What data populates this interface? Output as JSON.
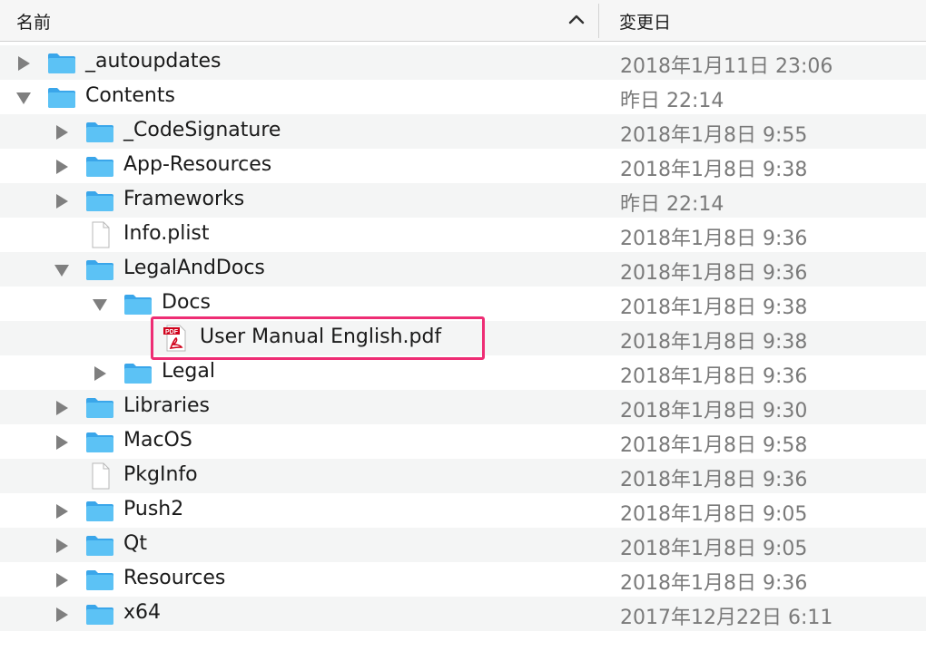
{
  "header": {
    "name_label": "名前",
    "date_label": "変更日",
    "sort_icon": "chevron-up-icon"
  },
  "highlight_color": "#ee2d74",
  "folder_color": "#5cc2f5",
  "rows": [
    {
      "name": "_autoupdates",
      "date": "2018年1月11日 23:06",
      "kind": "folder",
      "level": 0,
      "disclosure": "collapsed"
    },
    {
      "name": "Contents",
      "date": "昨日 22:14",
      "kind": "folder",
      "level": 0,
      "disclosure": "expanded"
    },
    {
      "name": "_CodeSignature",
      "date": "2018年1月8日 9:55",
      "kind": "folder",
      "level": 1,
      "disclosure": "collapsed"
    },
    {
      "name": "App-Resources",
      "date": "2018年1月8日 9:38",
      "kind": "folder",
      "level": 1,
      "disclosure": "collapsed"
    },
    {
      "name": "Frameworks",
      "date": "昨日 22:14",
      "kind": "folder",
      "level": 1,
      "disclosure": "collapsed"
    },
    {
      "name": "Info.plist",
      "date": "2018年1月8日 9:36",
      "kind": "file",
      "level": 1,
      "disclosure": "none"
    },
    {
      "name": "LegalAndDocs",
      "date": "2018年1月8日 9:36",
      "kind": "folder",
      "level": 1,
      "disclosure": "expanded"
    },
    {
      "name": "Docs",
      "date": "2018年1月8日 9:38",
      "kind": "folder",
      "level": 2,
      "disclosure": "expanded"
    },
    {
      "name": "User Manual English.pdf",
      "date": "2018年1月8日 9:38",
      "kind": "pdf",
      "level": 3,
      "disclosure": "none",
      "highlighted": true
    },
    {
      "name": "Legal",
      "date": "2018年1月8日 9:36",
      "kind": "folder",
      "level": 2,
      "disclosure": "collapsed"
    },
    {
      "name": "Libraries",
      "date": "2018年1月8日 9:30",
      "kind": "folder",
      "level": 1,
      "disclosure": "collapsed"
    },
    {
      "name": "MacOS",
      "date": "2018年1月8日 9:58",
      "kind": "folder",
      "level": 1,
      "disclosure": "collapsed"
    },
    {
      "name": "PkgInfo",
      "date": "2018年1月8日 9:36",
      "kind": "file",
      "level": 1,
      "disclosure": "none"
    },
    {
      "name": "Push2",
      "date": "2018年1月8日 9:05",
      "kind": "folder",
      "level": 1,
      "disclosure": "collapsed"
    },
    {
      "name": "Qt",
      "date": "2018年1月8日 9:05",
      "kind": "folder",
      "level": 1,
      "disclosure": "collapsed"
    },
    {
      "name": "Resources",
      "date": "2018年1月8日 9:36",
      "kind": "folder",
      "level": 1,
      "disclosure": "collapsed"
    },
    {
      "name": "x64",
      "date": "2017年12月22日 6:11",
      "kind": "folder",
      "level": 1,
      "disclosure": "collapsed"
    }
  ],
  "pdf_badge": "PDF"
}
